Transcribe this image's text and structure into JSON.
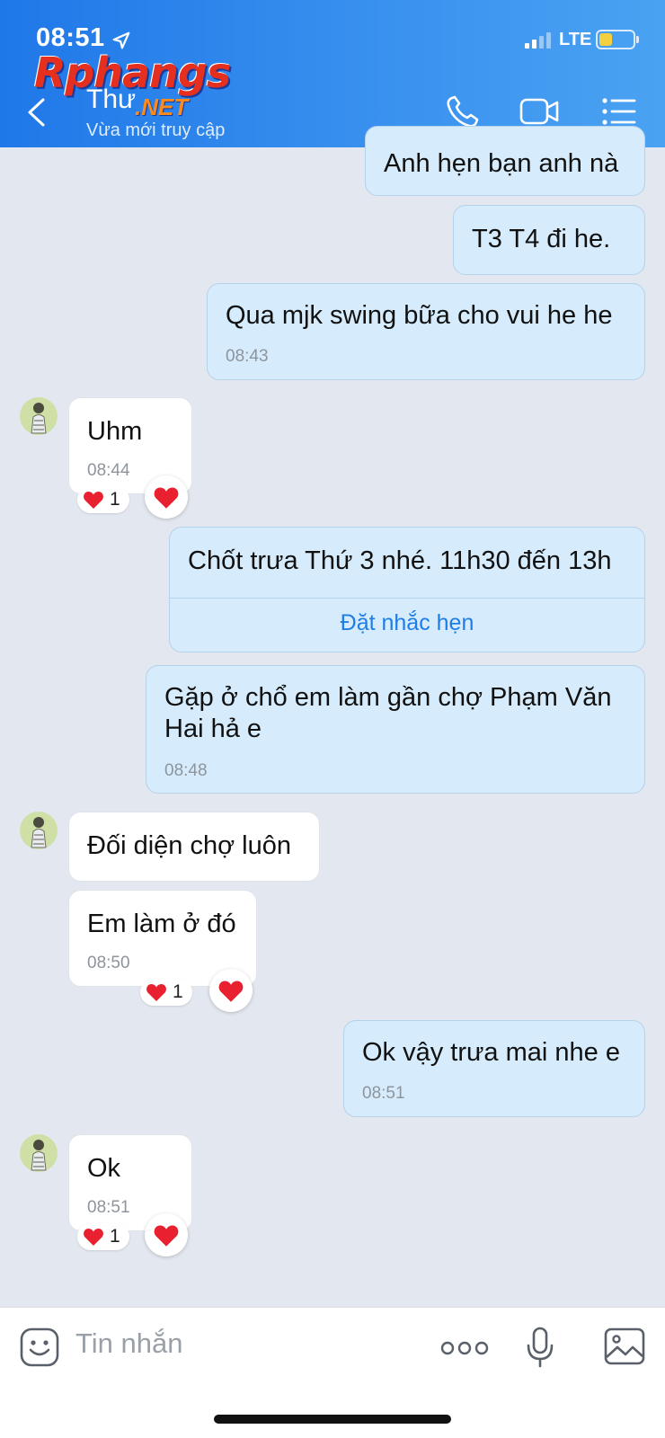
{
  "status_bar": {
    "time": "08:51",
    "network": "LTE"
  },
  "watermark": {
    "brand": "Rphangs",
    "suffix": ".NET"
  },
  "header": {
    "contact_name": "Thư",
    "contact_status": "Vừa mới truy cập"
  },
  "icons": {
    "back": "chevron-left-icon",
    "call": "phone-icon",
    "video": "video-camera-icon",
    "menu": "list-menu-icon",
    "emoji": "sticker-icon",
    "more": "more-dots-icon",
    "mic": "microphone-icon",
    "image": "image-icon",
    "reaction": "heart-icon"
  },
  "messages": [
    {
      "direction": "out",
      "text": "Anh hẹn bạn anh nà"
    },
    {
      "direction": "out",
      "text": "T3 T4 đi he."
    },
    {
      "direction": "out",
      "text": "Qua mjk swing bữa cho vui he he",
      "time": "08:43"
    },
    {
      "direction": "in",
      "text": "Uhm",
      "time": "08:44",
      "reaction_count": "1"
    },
    {
      "direction": "out",
      "text": "Chốt trưa Thứ 3 nhé. 11h30 đến 13h",
      "action": "Đặt nhắc hẹn"
    },
    {
      "direction": "out",
      "text": "Gặp ở chổ em làm gần chợ Phạm Văn Hai hả e",
      "time": "08:48"
    },
    {
      "direction": "in",
      "text": "Đối diện chợ luôn"
    },
    {
      "direction": "in",
      "text": "Em làm ở đó",
      "time": "08:50",
      "reaction_count": "1"
    },
    {
      "direction": "out",
      "text": "Ok vậy trưa mai nhe e",
      "time": "08:51"
    },
    {
      "direction": "in",
      "text": "Ok",
      "time": "08:51",
      "reaction_count": "1"
    }
  ],
  "input": {
    "placeholder": "Tin nhắn"
  },
  "colors": {
    "header": "#2f86ec",
    "outgoing_bubble": "#d6ecfc",
    "incoming_bubble": "#ffffff",
    "chat_bg": "#e3e7ef",
    "link": "#1e7de6",
    "heart": "#e8202f"
  }
}
